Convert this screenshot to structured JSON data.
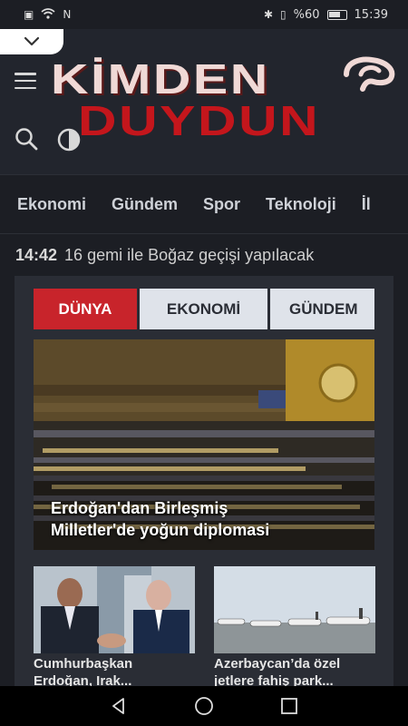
{
  "status_bar": {
    "battery": "%60",
    "time": "15:39"
  },
  "header": {
    "logo_line1": "KİMDEN",
    "logo_line2": "DUYDUN"
  },
  "nav": [
    "Ekonomi",
    "Gündem",
    "Spor",
    "Teknoloji",
    "İl"
  ],
  "ticker": {
    "time": "14:42",
    "text": "16 gemi ile Boğaz geçişi yapılacak"
  },
  "tabs": [
    "DÜNYA",
    "EKONOMİ",
    "GÜNDEM"
  ],
  "hero": {
    "title_line1": "Erdoğan'dan Birleşmiş",
    "title_line2": "Milletler'de yoğun diplomasi"
  },
  "cards": [
    {
      "title_line1": "Cumhurbaşkan",
      "title_line2": "Erdoğan, Irak..."
    },
    {
      "title_line1": "Azerbaycan’da özel",
      "title_line2": "jetlere fahiş park..."
    }
  ],
  "colors": {
    "accent_red": "#c8242b",
    "background": "#1c1e24",
    "tab_inactive": "#dfe3ea"
  },
  "icons": [
    "hamburger-icon",
    "search-icon",
    "contrast-icon",
    "chevron-down-icon",
    "back-icon",
    "home-icon",
    "recents-icon"
  ]
}
